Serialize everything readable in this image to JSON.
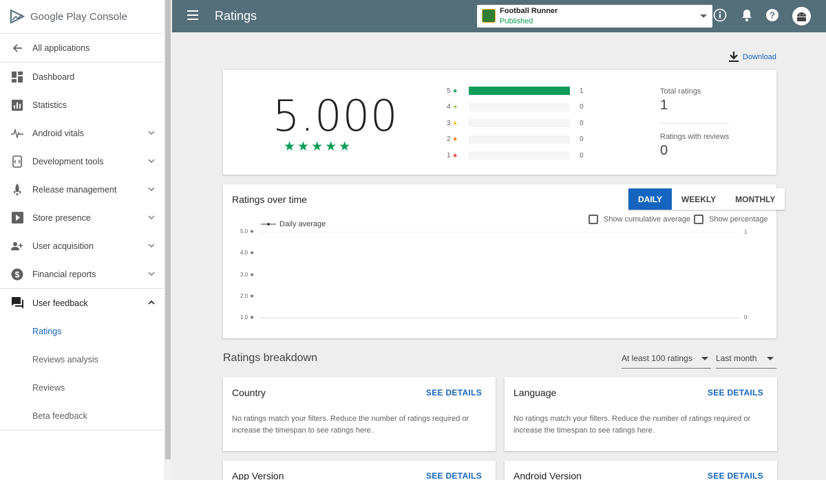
{
  "sidebar": {
    "brand": "Google Play",
    "brand_suffix": "Console",
    "all_apps": "All applications",
    "items": [
      {
        "label": "Dashboard",
        "icon": "dashboard-icon"
      },
      {
        "label": "Statistics",
        "icon": "bar-chart-icon"
      },
      {
        "label": "Android vitals",
        "icon": "pulse-icon"
      },
      {
        "label": "Development tools",
        "icon": "dev-tools-icon"
      },
      {
        "label": "Release management",
        "icon": "rocket-icon"
      },
      {
        "label": "Store presence",
        "icon": "store-icon"
      },
      {
        "label": "User acquisition",
        "icon": "user-add-icon"
      },
      {
        "label": "Financial reports",
        "icon": "dollar-icon"
      },
      {
        "label": "User feedback",
        "icon": "feedback-icon"
      }
    ],
    "sub_items": [
      "Ratings",
      "Reviews analysis",
      "Reviews",
      "Beta feedback"
    ]
  },
  "topbar": {
    "title": "Ratings",
    "app_name": "Football Runner",
    "app_status": "Published"
  },
  "main": {
    "download": "Download",
    "summary": {
      "score": "5.000",
      "stars": "★★★★★",
      "distribution": [
        {
          "stars": "5",
          "count": "1",
          "fraction": 1.0,
          "color": "#0f9d58"
        },
        {
          "stars": "4",
          "count": "0",
          "fraction": 0,
          "color": "#9ccc65"
        },
        {
          "stars": "3",
          "count": "0",
          "fraction": 0,
          "color": "#fbc02d"
        },
        {
          "stars": "2",
          "count": "0",
          "fraction": 0,
          "color": "#f57c00"
        },
        {
          "stars": "1",
          "count": "0",
          "fraction": 0,
          "color": "#e53935"
        }
      ],
      "total_label": "Total ratings",
      "total_value": "1",
      "reviews_label": "Ratings with reviews",
      "reviews_value": "0"
    },
    "over_time": {
      "title": "Ratings over time",
      "tabs": [
        "DAILY",
        "WEEKLY",
        "MONTHLY"
      ],
      "active_tab": "DAILY",
      "cumulative": "Show cumulative average",
      "percentage": "Show percentage",
      "legend": "Daily average",
      "y_ticks": [
        "5.0 ★",
        "4.0 ★",
        "3.0 ★",
        "2.0 ★",
        "1.0 ★"
      ],
      "right_ticks": [
        "1",
        "0"
      ]
    },
    "breakdown": {
      "title": "Ratings breakdown",
      "filter_min": "At least 100 ratings",
      "filter_period": "Last month",
      "see_details": "SEE DETAILS",
      "empty_msg": "No ratings match your filters. Reduce the number of ratings required or increase the timespan to see ratings here.",
      "cards": [
        "Country",
        "Language",
        "App Version",
        "Android Version"
      ]
    }
  }
}
